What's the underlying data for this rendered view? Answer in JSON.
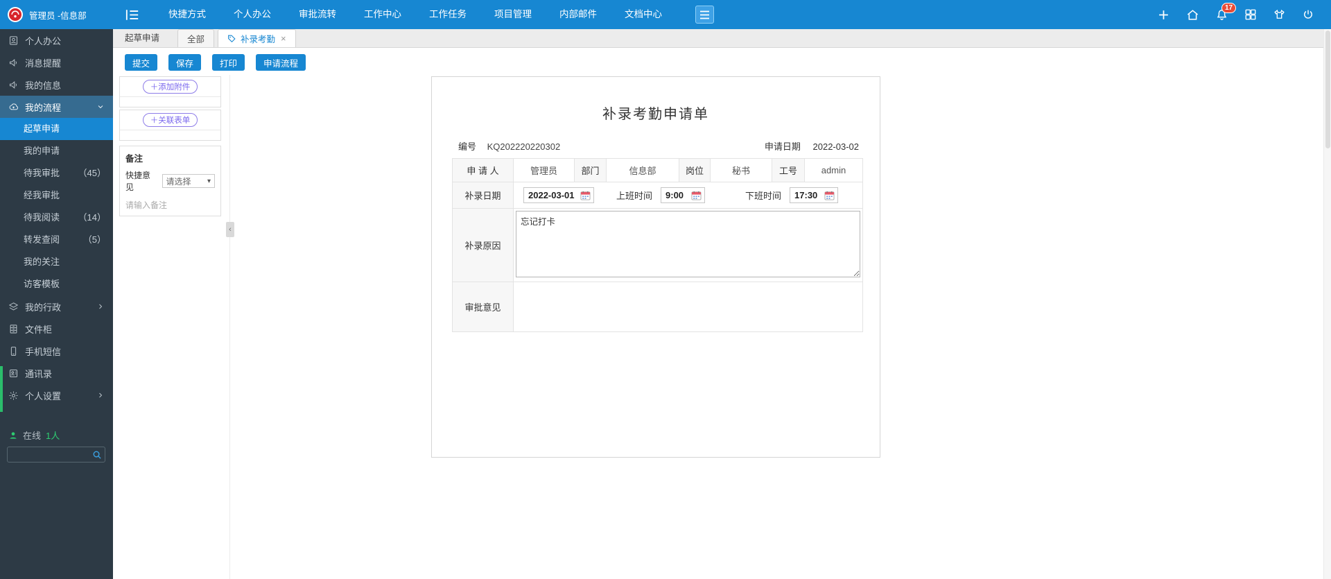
{
  "topbar": {
    "user": "管理员 -信息部",
    "nav": [
      "快捷方式",
      "个人办公",
      "审批流转",
      "工作中心",
      "工作任务",
      "项目管理",
      "内部邮件",
      "文档中心"
    ],
    "notification_badge": "17"
  },
  "sidebar": {
    "items": [
      {
        "label": "个人办公"
      },
      {
        "label": "消息提醒"
      },
      {
        "label": "我的信息"
      },
      {
        "label": "我的流程"
      },
      {
        "label": "我的行政"
      },
      {
        "label": "文件柜"
      },
      {
        "label": "手机短信"
      },
      {
        "label": "通讯录"
      },
      {
        "label": "个人设置"
      }
    ],
    "process_submenu": [
      {
        "label": "起草申请"
      },
      {
        "label": "我的申请"
      },
      {
        "label": "待我审批",
        "count": "（45）"
      },
      {
        "label": "经我审批"
      },
      {
        "label": "待我阅读",
        "count": "（14）"
      },
      {
        "label": "转发查阅",
        "count": "（5）"
      },
      {
        "label": "我的关注"
      },
      {
        "label": "访客模板"
      }
    ],
    "online_label": "在线",
    "online_count": "1人"
  },
  "tabs": {
    "module": "起草申请",
    "tab_all": "全部",
    "tab_active": "补录考勤"
  },
  "toolbar": {
    "submit": "提交",
    "save": "保存",
    "print": "打印",
    "flow": "申请流程"
  },
  "panel": {
    "add_attachment": "＋添加附件",
    "link_form": "＋关联表单",
    "remark_title": "备注",
    "quick_opinion_label": "快捷意见",
    "quick_opinion_value": "请选择",
    "remark_placeholder": "请输入备注"
  },
  "form": {
    "title": "补录考勤申请单",
    "no_label": "编号",
    "no_value": "KQ202220220302",
    "apply_date_label": "申请日期",
    "apply_date_value": "2022-03-02",
    "applicant_label": "申 请 人",
    "applicant_value": "管理员",
    "dept_label": "部门",
    "dept_value": "信息部",
    "post_label": "岗位",
    "post_value": "秘书",
    "empno_label": "工号",
    "empno_value": "admin",
    "makeup_date_label": "补录日期",
    "makeup_date_value": "2022-03-01",
    "start_time_label": "上班时间",
    "start_time_value": "9:00",
    "end_time_label": "下班时间",
    "end_time_value": "17:30",
    "reason_label": "补录原因",
    "reason_value": "忘记打卡",
    "approval_label": "审批意见"
  },
  "icons": {
    "close": "×",
    "caret": "▾",
    "collapse": "‹"
  }
}
